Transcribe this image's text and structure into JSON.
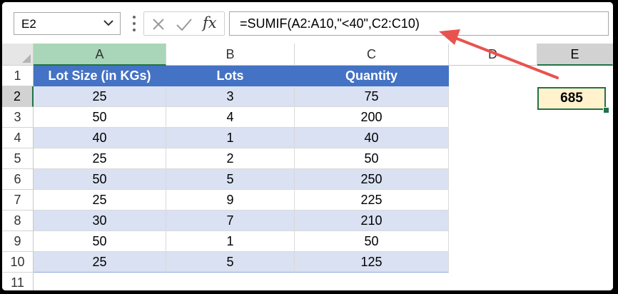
{
  "name_box": {
    "value": "E2"
  },
  "formula_bar": {
    "cancel_glyph": "✕",
    "enter_glyph": "✓",
    "fx_label": "fx",
    "formula": "=SUMIF(A2:A10,\"<40\",C2:C10)"
  },
  "columns": [
    "A",
    "B",
    "C",
    "D",
    "E"
  ],
  "rows": [
    "1",
    "2",
    "3",
    "4",
    "5",
    "6",
    "7",
    "8",
    "9",
    "10",
    "11"
  ],
  "table": {
    "headers": [
      "Lot Size (in KGs)",
      "Lots",
      "Quantity"
    ],
    "data": [
      [
        "25",
        "3",
        "75"
      ],
      [
        "50",
        "4",
        "200"
      ],
      [
        "40",
        "1",
        "40"
      ],
      [
        "25",
        "2",
        "50"
      ],
      [
        "50",
        "5",
        "250"
      ],
      [
        "25",
        "9",
        "225"
      ],
      [
        "30",
        "7",
        "210"
      ],
      [
        "50",
        "1",
        "50"
      ],
      [
        "25",
        "5",
        "125"
      ]
    ]
  },
  "result_cell": {
    "value": "685"
  },
  "colors": {
    "table_header": "#4472c4",
    "band": "#d9e1f2",
    "result_fill": "#fff2cc",
    "selection": "#217346",
    "arrow": "#e8534f"
  }
}
